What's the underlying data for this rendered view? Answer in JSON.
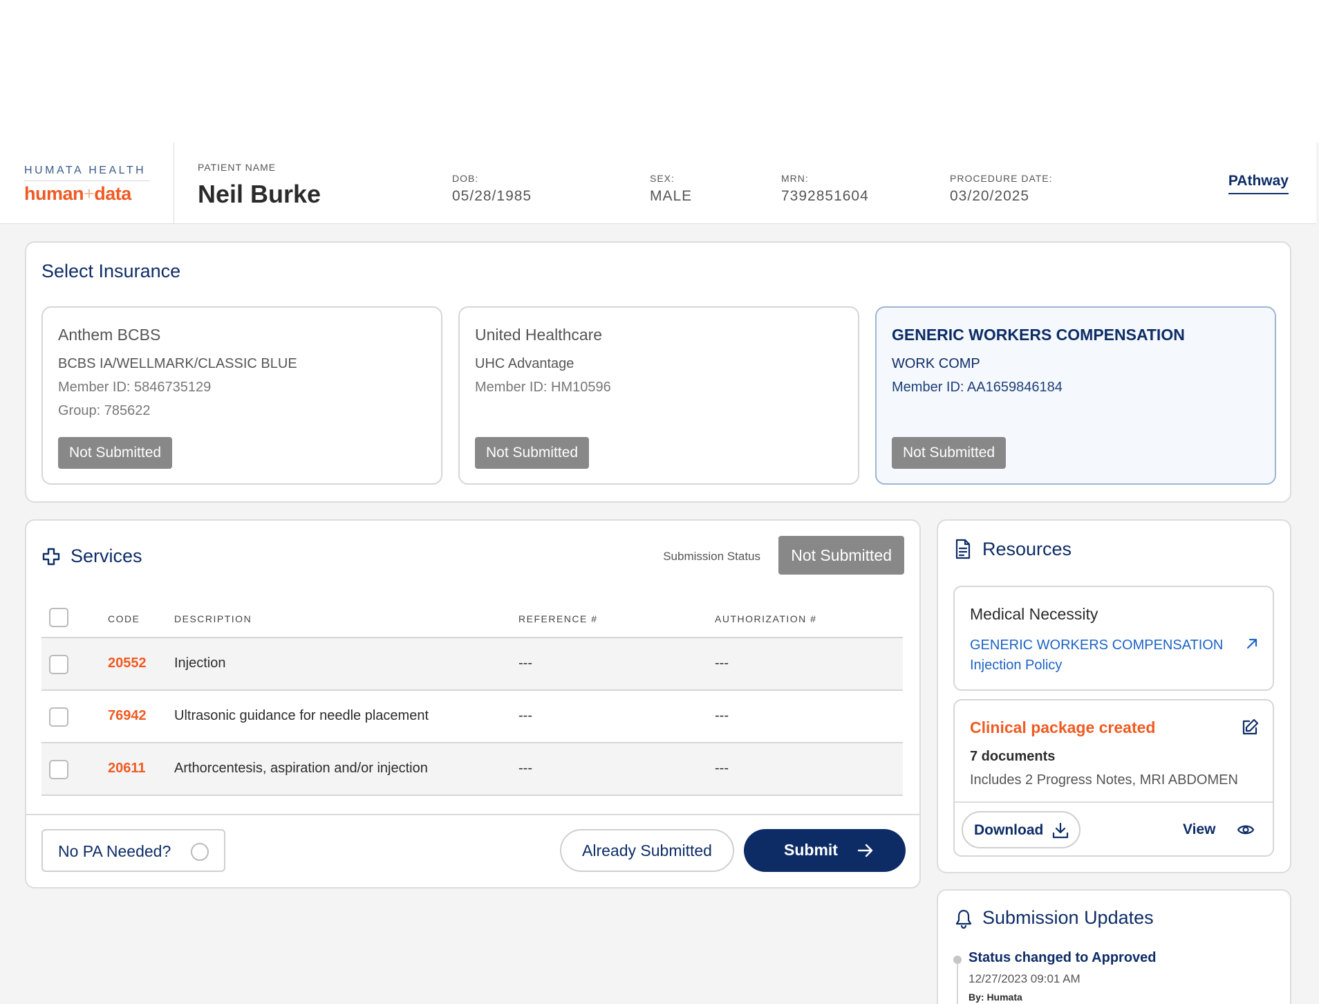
{
  "header": {
    "logo_top": "HUMATA HEALTH",
    "logo_bottom_a": "human",
    "logo_bottom_b": "+",
    "logo_bottom_c": "data",
    "patient_name_label": "PATIENT NAME",
    "patient_name": "Neil Burke",
    "fields": [
      {
        "label": "DOB:",
        "value": "05/28/1985"
      },
      {
        "label": "SEX:",
        "value": "MALE"
      },
      {
        "label": "MRN:",
        "value": "7392851604"
      },
      {
        "label": "PROCEDURE DATE:",
        "value": "03/20/2025"
      }
    ],
    "pathway_link": "PAthway"
  },
  "insurance": {
    "title": "Select Insurance",
    "cards": [
      {
        "name": "Anthem BCBS",
        "plan": "BCBS IA/WELLMARK/CLASSIC BLUE",
        "member_id": "Member ID: 5846735129",
        "group": "Group: 785622",
        "status": "Not Submitted",
        "selected": false
      },
      {
        "name": "United Healthcare",
        "plan": "UHC Advantage",
        "member_id": "Member ID: HM10596",
        "group": "",
        "status": "Not Submitted",
        "selected": false
      },
      {
        "name": "GENERIC WORKERS COMPENSATION",
        "plan": "WORK COMP",
        "member_id": "Member ID: AA1659846184",
        "group": "",
        "status": "Not Submitted",
        "selected": true
      }
    ]
  },
  "services": {
    "title": "Services",
    "submission_status_label": "Submission Status",
    "submission_status": "Not Submitted",
    "columns": [
      "CODE",
      "DESCRIPTION",
      "REFERENCE #",
      "AUTHORIZATION #"
    ],
    "rows": [
      {
        "code": "20552",
        "description": "Injection",
        "reference": "---",
        "authorization": "---"
      },
      {
        "code": "76942",
        "description": "Ultrasonic guidance for needle placement",
        "reference": "---",
        "authorization": "---"
      },
      {
        "code": "20611",
        "description": "Arthorcentesis, aspiration and/or injection",
        "reference": "---",
        "authorization": "---"
      }
    ],
    "no_pa_label": "No PA Needed?",
    "already_submitted_label": "Already Submitted",
    "submit_label": "Submit"
  },
  "resources": {
    "title": "Resources",
    "medical_necessity": {
      "title": "Medical Necessity",
      "link_line1": "GENERIC WORKERS COMPENSATION",
      "link_line2": "Injection Policy"
    },
    "package": {
      "title": "Clinical package created",
      "docs": "7 documents",
      "includes": "Includes 2 Progress Notes, MRI ABDOMEN",
      "download_label": "Download",
      "view_label": "View"
    }
  },
  "updates": {
    "title": "Submission Updates",
    "items": [
      {
        "title": "Status changed to Approved",
        "time": "12/27/2023 09:01 AM",
        "by": "By: Humata"
      }
    ]
  },
  "colors": {
    "navy": "#0d2c66",
    "orange": "#f05a22",
    "status_gray": "#888888",
    "link_blue": "#1c63c4"
  }
}
